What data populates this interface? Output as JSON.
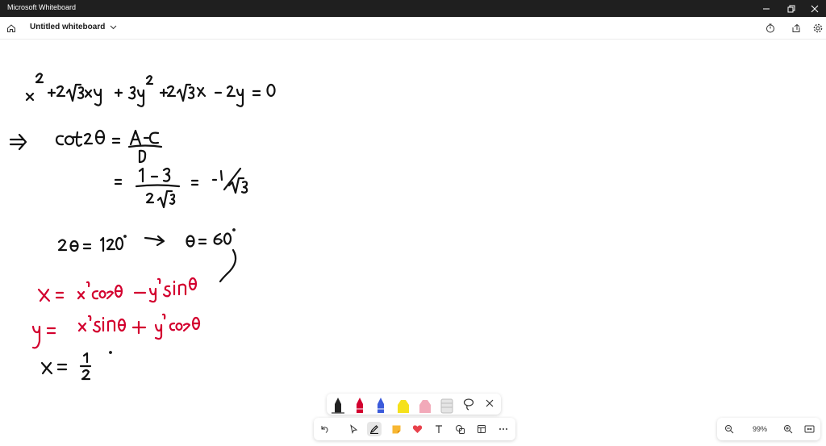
{
  "window": {
    "title": "Microsoft Whiteboard",
    "controls": [
      "minimize-icon",
      "restore-icon",
      "close-icon"
    ]
  },
  "appbar": {
    "board_name": "Untitled whiteboard",
    "left_icons": [
      "home-icon"
    ],
    "right_icons": [
      "timer-icon",
      "share-icon",
      "settings-icon"
    ]
  },
  "canvas": {
    "ink_colors": {
      "black": "#111111",
      "red": "#d3002f"
    },
    "ink_lines": [
      "x² + 2√3xy + 3y² + 2√3x − 2y = 0",
      "⇒ cot2θ = A − C / B",
      "= 1 − 3 / 2√3 = −1/√3",
      "2θ = 120° ⟶ θ = 60°",
      "x = x′cosθ − y′sinθ",
      "y = x′sinθ + y′cosθ",
      "x = 1/2"
    ]
  },
  "pen_tray": {
    "pens": [
      {
        "name": "black-pen",
        "color": "#222222"
      },
      {
        "name": "red-pen",
        "color": "#d3002f"
      },
      {
        "name": "blue-pen",
        "color": "#3b5bdb"
      },
      {
        "name": "yellow-highlighter",
        "color": "#f5e11b"
      },
      {
        "name": "pink-highlighter",
        "color": "#f2a9b9"
      },
      {
        "name": "eraser",
        "color": "#cfcfcf"
      }
    ]
  },
  "toolbar": {
    "tools": [
      "undo-icon",
      "select-icon",
      "pen-icon",
      "sticky-note-icon",
      "reaction-icon",
      "text-icon",
      "shapes-icon",
      "templates-icon",
      "more-icon"
    ],
    "active_tool": "pen-icon"
  },
  "zoom": {
    "level": "99%"
  }
}
